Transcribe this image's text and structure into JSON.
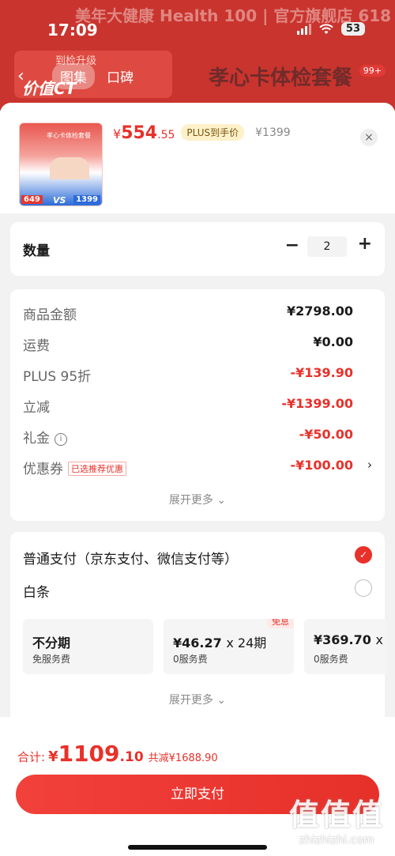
{
  "status_bar": {
    "time": "17:09",
    "battery": "53"
  },
  "store_banner": {
    "brand": "美年大健康 Health 100 | 官方旗舰店 618",
    "promo_small": "到检升级",
    "promo_big": "价值CT"
  },
  "nav": {
    "tabs": [
      {
        "label": "图集",
        "active": true
      },
      {
        "label": "口碑",
        "active": false
      }
    ],
    "title": "孝心卡体检套餐",
    "cart_badge": "99+"
  },
  "product": {
    "thumb_title": "孝心卡体检套餐",
    "thumb_price_left": "649",
    "thumb_vs": "VS",
    "thumb_price_right": "1399",
    "price_symbol": "¥",
    "price_int": "554",
    "price_dec": ".55",
    "plus_tag": "PLUS到手价",
    "original_price": "¥1399",
    "close": "×"
  },
  "quantity": {
    "label": "数量",
    "minus": "−",
    "value": "2",
    "plus": "+"
  },
  "price_details": {
    "rows": [
      {
        "label": "商品金额",
        "value": "¥2798.00",
        "red": false
      },
      {
        "label": "运费",
        "value": "¥0.00",
        "red": false
      },
      {
        "label": "PLUS 95折",
        "value": "-¥139.90",
        "red": true
      },
      {
        "label": "立减",
        "value": "-¥1399.00",
        "red": true
      },
      {
        "label": "礼金",
        "value": "-¥50.00",
        "red": true,
        "info": "i"
      },
      {
        "label": "优惠券",
        "value": "-¥100.00",
        "red": true,
        "tag": "已选推荐优惠",
        "chevron": "›"
      }
    ],
    "expand_more": "展开更多 ⌄"
  },
  "payment": {
    "options": [
      {
        "label": "普通支付（京东支付、微信支付等）",
        "checked": true,
        "check_mark": "✓"
      },
      {
        "label": "白条",
        "checked": false
      }
    ],
    "installments": [
      {
        "main": "不分期",
        "sub": "免服务费"
      },
      {
        "amount": "¥46.27",
        "times": "x 24期",
        "sub": "0服务费",
        "badge": "免息"
      },
      {
        "amount": "¥369.70",
        "times": "x",
        "sub": "0服务费"
      }
    ],
    "expand_more": "展开更多 ⌄"
  },
  "footer": {
    "total_label": "合计:",
    "total_symbol": "¥",
    "total_int": "1109",
    "total_dec": ".10",
    "saving": "共减¥1688.90",
    "pay_button": "立即支付"
  },
  "watermark": {
    "big": "值值值",
    "small": "zhizhizhi.com"
  },
  "colors": {
    "accent": "#e8312a",
    "banner": "#c9342e",
    "plus_tag_bg": "#fdf1c9"
  },
  "icons": [
    "back-icon",
    "close-icon",
    "info-icon",
    "chevron-right-icon",
    "check-icon",
    "wifi-icon",
    "signal-icon",
    "battery-icon"
  ]
}
